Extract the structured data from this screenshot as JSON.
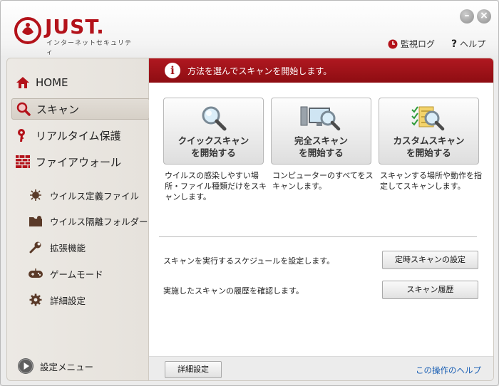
{
  "header": {
    "logo_text": "JUST.",
    "logo_subtitle": "インターネットセキュリティ",
    "monitor_log": "監視ログ",
    "help": "ヘルプ",
    "minimize_glyph": "–",
    "close_glyph": "×"
  },
  "sidebar": {
    "main_items": [
      {
        "label": "HOME",
        "icon": "home-icon"
      },
      {
        "label": "スキャン",
        "icon": "scan-icon",
        "active": true
      },
      {
        "label": "リアルタイム保護",
        "icon": "key-icon"
      },
      {
        "label": "ファイアウォール",
        "icon": "firewall-icon"
      }
    ],
    "sub_items": [
      {
        "label": "ウイルス定義ファイル",
        "icon": "virus-definition-icon"
      },
      {
        "label": "ウイルス隔離フォルダー",
        "icon": "quarantine-folder-icon"
      },
      {
        "label": "拡張機能",
        "icon": "wrench-icon"
      },
      {
        "label": "ゲームモード",
        "icon": "gamepad-icon"
      },
      {
        "label": "詳細設定",
        "icon": "gear-icon"
      }
    ],
    "settings_menu": "設定メニュー"
  },
  "main": {
    "banner": "方法を選んでスキャンを開始します。",
    "cards": [
      {
        "line1": "クイックスキャン",
        "line2": "を開始する",
        "desc": "ウイルスの感染しやすい場所・ファイル種類だけをスキャンします。"
      },
      {
        "line1": "完全スキャン",
        "line2": "を開始する",
        "desc": "コンピューターのすべてをスキャンします。"
      },
      {
        "line1": "カスタムスキャン",
        "line2": "を開始する",
        "desc": "スキャンする場所や動作を指定してスキャンします。"
      }
    ],
    "schedule_text": "スキャンを実行するスケジュールを設定します。",
    "schedule_button": "定時スキャンの設定",
    "history_text": "実施したスキャンの履歴を確認します。",
    "history_button": "スキャン履歴",
    "detail_button": "詳細設定",
    "help_link": "この操作のヘルプ"
  },
  "colors": {
    "brand_red": "#b3121a",
    "link_blue": "#1a5fb4"
  }
}
